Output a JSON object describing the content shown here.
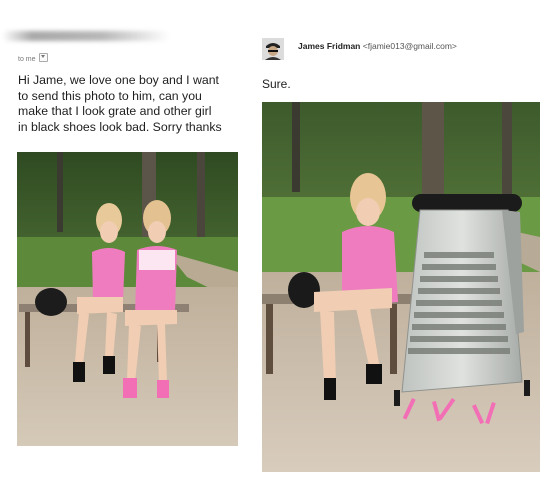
{
  "left_panel": {
    "recipient_label": "to me",
    "message": "Hi Jame, we love one boy and I want\nto send this photo to him, can you\nmake that I look grate and other girl\nin black shoes look bad. Sorry thanks"
  },
  "right_panel": {
    "sender_name": "James Fridman",
    "sender_email": "<fjamie013@gmail.com>",
    "message": "Sure."
  },
  "colors": {
    "pink_dress": "#f07cc0",
    "forest_green": "#3a5a2a",
    "grass": "#5d8a3a",
    "ground": "#c9bba8",
    "grater_metal": "#c5c8c4"
  },
  "icons": {
    "dropdown": "chevron-down-icon"
  }
}
